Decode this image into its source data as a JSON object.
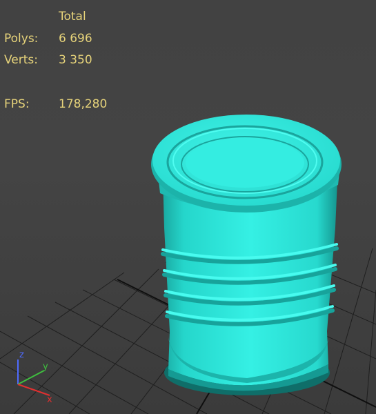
{
  "stats": {
    "header": "Total",
    "polys_label": "Polys:",
    "polys_value": "6 696",
    "verts_label": "Verts:",
    "verts_value": "3 350",
    "fps_label": "FPS:",
    "fps_value": "178,280"
  },
  "axis": {
    "z": "z",
    "y": "y",
    "x": "x"
  },
  "colors": {
    "background": "#434343",
    "grid": "#1e1e1e",
    "object": "#2ee6da",
    "stats_text": "#e6d37a",
    "axis_z": "#4f6bff",
    "axis_y": "#3fbf3f",
    "axis_x": "#e23030"
  }
}
